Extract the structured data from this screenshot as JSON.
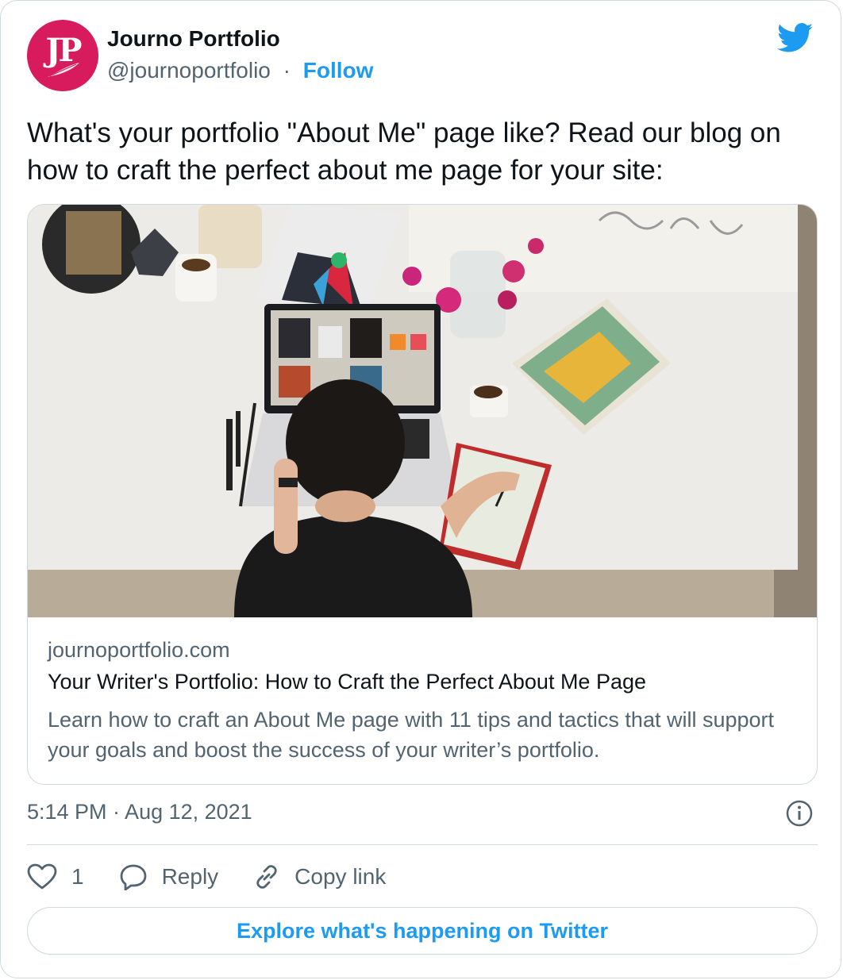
{
  "author": {
    "avatar_monogram": "JP",
    "name": "Journo Portfolio",
    "handle": "@journoportfolio",
    "separator": "·",
    "follow_label": "Follow"
  },
  "tweet": {
    "text": "What's your portfolio \"About Me\" page like? Read our blog on how to craft the perfect about me page for your site:"
  },
  "link_card": {
    "domain": "journoportfolio.com",
    "title": "Your Writer's Portfolio: How to Craft the Perfect About Me Page",
    "description": "Learn how to craft an About Me page with 11 tips and tactics that will support your goals and boost the success of your writer’s portfolio."
  },
  "meta": {
    "timestamp": "5:14 PM · Aug 12, 2021"
  },
  "actions": {
    "like_count": "1",
    "reply_label": "Reply",
    "copy_link_label": "Copy link"
  },
  "explore_label": "Explore what's happening on Twitter",
  "icons": {
    "brand": "twitter-bird-icon",
    "info": "info-icon",
    "like": "heart-icon",
    "reply": "speech-bubble-icon",
    "copy": "link-icon"
  },
  "colors": {
    "accent": "#1d9bf0",
    "avatar_bg": "#d81b5c",
    "secondary_text": "#536471",
    "border": "#cfd9de"
  }
}
